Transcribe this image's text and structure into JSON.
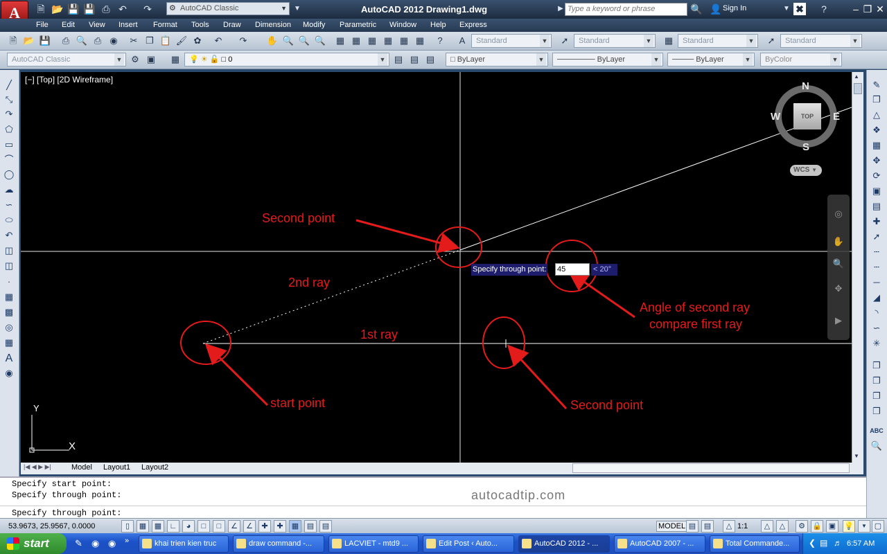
{
  "app": {
    "title": "AutoCAD 2012    Drawing1.dwg",
    "logo_letter": "A",
    "workspace": "AutoCAD Classic",
    "search_placeholder": "Type a keyword or phrase",
    "sign_in": "Sign In"
  },
  "menu": [
    "File",
    "Edit",
    "View",
    "Insert",
    "Format",
    "Tools",
    "Draw",
    "Dimension",
    "Modify",
    "Parametric",
    "Window",
    "Help",
    "Express"
  ],
  "toolbar1": {
    "text_style": "Standard",
    "dim_style": "Standard",
    "table_style": "Standard",
    "mleader_style": "Standard"
  },
  "toolbar2": {
    "workspace": "AutoCAD Classic",
    "layer": "0",
    "color": "ByLayer",
    "linetype": "ByLayer",
    "lineweight": "ByLayer",
    "plotstyle": "ByColor"
  },
  "viewport": {
    "label": "[−] [Top] [2D Wireframe]",
    "ucs_x": "X",
    "ucs_y": "Y",
    "compass": {
      "n": "N",
      "s": "S",
      "e": "E",
      "w": "W",
      "top": "TOP"
    },
    "wcs": "WCS"
  },
  "annotations": {
    "second_point_top": "Second point",
    "second_ray": "2nd ray",
    "first_ray": "1st ray",
    "start_point": "start point",
    "second_point_bottom": "Second point",
    "angle_note_1": "Angle of second ray",
    "angle_note_2": "compare first ray"
  },
  "dynamic_input": {
    "prompt": "Specify through point:",
    "value": "45",
    "angle": "< 20°"
  },
  "layout_tabs": [
    "Model",
    "Layout1",
    "Layout2"
  ],
  "command_history": [
    "Specify start point:",
    "Specify through point:"
  ],
  "command_prompt": "Specify through point:",
  "watermark": "autocadtip.com",
  "status": {
    "coordinates": "53.9673, 25.9567, 0.0000",
    "model": "MODEL",
    "scale": "1:1"
  },
  "taskbar": {
    "start": "start",
    "tasks": [
      {
        "label": "khai trien kien truc",
        "active": false
      },
      {
        "label": "draw command -...",
        "active": false
      },
      {
        "label": "LACVIET - mtd9 ...",
        "active": false
      },
      {
        "label": "Edit Post ‹ Auto...",
        "active": false
      },
      {
        "label": "AutoCAD 2012 - ...",
        "active": true
      },
      {
        "label": "AutoCAD 2007 - ...",
        "active": false
      },
      {
        "label": "Total Commande...",
        "active": false
      }
    ],
    "clock": "6:57 AM"
  },
  "colors": {
    "annotation": "#e41b1b",
    "viewport_bg": "#000000",
    "prompt_bg": "#1d1d6c"
  }
}
